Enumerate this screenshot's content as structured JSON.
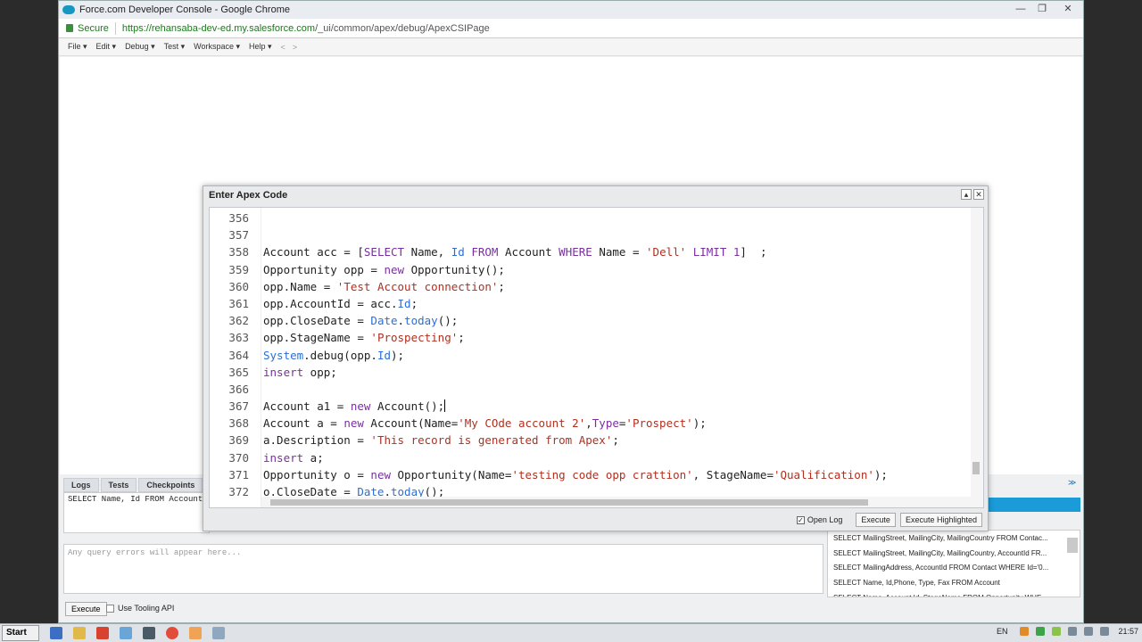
{
  "browser": {
    "title": "Force.com Developer Console - Google Chrome",
    "secure_label": "Secure",
    "url_host": "https://rehansaba-dev-ed.my.salesforce.com",
    "url_path": "/_ui/common/apex/debug/ApexCSIPage"
  },
  "menu": {
    "items": [
      "File ▾",
      "Edit ▾",
      "Debug ▾",
      "Test ▾",
      "Workspace ▾",
      "Help ▾"
    ],
    "back": "<",
    "forward": ">"
  },
  "dialog": {
    "title": "Enter Apex Code",
    "open_log_label": "Open Log",
    "execute_label": "Execute",
    "execute_highlighted_label": "Execute Highlighted"
  },
  "code_lines": [
    {
      "n": "356"
    },
    {
      "n": "357"
    },
    {
      "n": "358"
    },
    {
      "n": "359"
    },
    {
      "n": "360"
    },
    {
      "n": "361"
    },
    {
      "n": "362"
    },
    {
      "n": "363"
    },
    {
      "n": "364"
    },
    {
      "n": "365"
    },
    {
      "n": "366"
    },
    {
      "n": "367"
    },
    {
      "n": "368"
    },
    {
      "n": "369"
    },
    {
      "n": "370"
    },
    {
      "n": "371"
    },
    {
      "n": "372"
    }
  ],
  "bottom": {
    "tabs": [
      "Logs",
      "Tests",
      "Checkpoints"
    ],
    "query_text": "SELECT Name, Id FROM Account",
    "errors_placeholder": "Any query errors will appear here...",
    "execute_label": "Execute",
    "tooling_label": "Use Tooling API",
    "history": [
      "SELECT MailingStreet, MailingCity, MailingCountry FROM Contac...",
      "SELECT MailingStreet, MailingCity, MailingCountry, AccountId FR...",
      "SELECT MailingAddress, AccountId FROM Contact WHERE Id='0...",
      "SELECT Name, Id,Phone, Type, Fax FROM Account",
      "SELECT Name, Account.Id, StageName FROM Opportunity WHE..."
    ]
  },
  "taskbar": {
    "start_label": "Start",
    "lang": "EN",
    "clock": "21:57"
  },
  "colors": {
    "keyword": "#7a2fa0",
    "string": "#b03020",
    "method": "#2b6fd6",
    "history_bar": "#1b9bd7"
  }
}
